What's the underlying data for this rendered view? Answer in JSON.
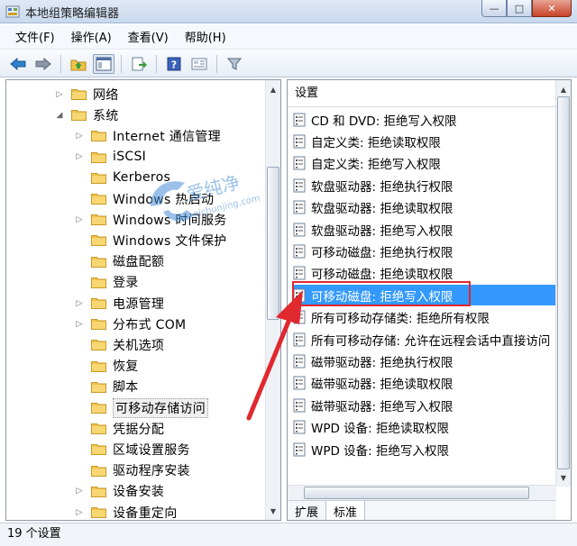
{
  "window": {
    "title": "本地组策略编辑器",
    "min_label": "—",
    "max_label": "□",
    "close_label": "✕"
  },
  "menu": [
    "文件(F)",
    "操作(A)",
    "查看(V)",
    "帮助(H)"
  ],
  "toolbar": [
    "back-icon",
    "forward-icon",
    "up-folder-icon",
    "show-hide-tree-icon",
    "export-icon",
    "help-icon",
    "properties-icon",
    "filter-icon"
  ],
  "tree": {
    "items": [
      {
        "label": "网络",
        "expander": "▷"
      },
      {
        "label": "系统",
        "expander": "◢"
      },
      {
        "label": "Internet 通信管理",
        "expander": "▷"
      },
      {
        "label": "iSCSI",
        "expander": "▷"
      },
      {
        "label": "Kerberos",
        "expander": ""
      },
      {
        "label": "Windows 热启动",
        "expander": ""
      },
      {
        "label": "Windows 时间服务",
        "expander": "▷"
      },
      {
        "label": "Windows 文件保护",
        "expander": ""
      },
      {
        "label": "磁盘配额",
        "expander": ""
      },
      {
        "label": "登录",
        "expander": ""
      },
      {
        "label": "电源管理",
        "expander": "▷"
      },
      {
        "label": "分布式 COM",
        "expander": "▷"
      },
      {
        "label": "关机选项",
        "expander": ""
      },
      {
        "label": "恢复",
        "expander": ""
      },
      {
        "label": "脚本",
        "expander": ""
      },
      {
        "label": "可移动存储访问",
        "expander": ""
      },
      {
        "label": "凭据分配",
        "expander": ""
      },
      {
        "label": "区域设置服务",
        "expander": ""
      },
      {
        "label": "驱动程序安装",
        "expander": ""
      },
      {
        "label": "设备安装",
        "expander": "▷"
      },
      {
        "label": "设备重定向",
        "expander": "▷"
      }
    ]
  },
  "list": {
    "header": "设置",
    "items": [
      "CD 和 DVD: 拒绝写入权限",
      "自定义类: 拒绝读取权限",
      "自定义类: 拒绝写入权限",
      "软盘驱动器: 拒绝执行权限",
      "软盘驱动器: 拒绝读取权限",
      "软盘驱动器: 拒绝写入权限",
      "可移动磁盘: 拒绝执行权限",
      "可移动磁盘: 拒绝读取权限",
      "可移动磁盘: 拒绝写入权限",
      "所有可移动存储类: 拒绝所有权限",
      "所有可移动存储: 允许在远程会话中直接访问",
      "磁带驱动器: 拒绝执行权限",
      "磁带驱动器: 拒绝读取权限",
      "磁带驱动器: 拒绝写入权限",
      "WPD 设备: 拒绝读取权限",
      "WPD 设备: 拒绝写入权限"
    ],
    "selected_index": 8
  },
  "tabs": [
    "扩展",
    "标准"
  ],
  "status": "19 个设置",
  "watermark": {
    "text": "爱纯净",
    "url": "aichunjing.com"
  },
  "colors": {
    "selection": "#3399ff",
    "annotation": "#e0282f",
    "folder": "#f2c24a"
  }
}
